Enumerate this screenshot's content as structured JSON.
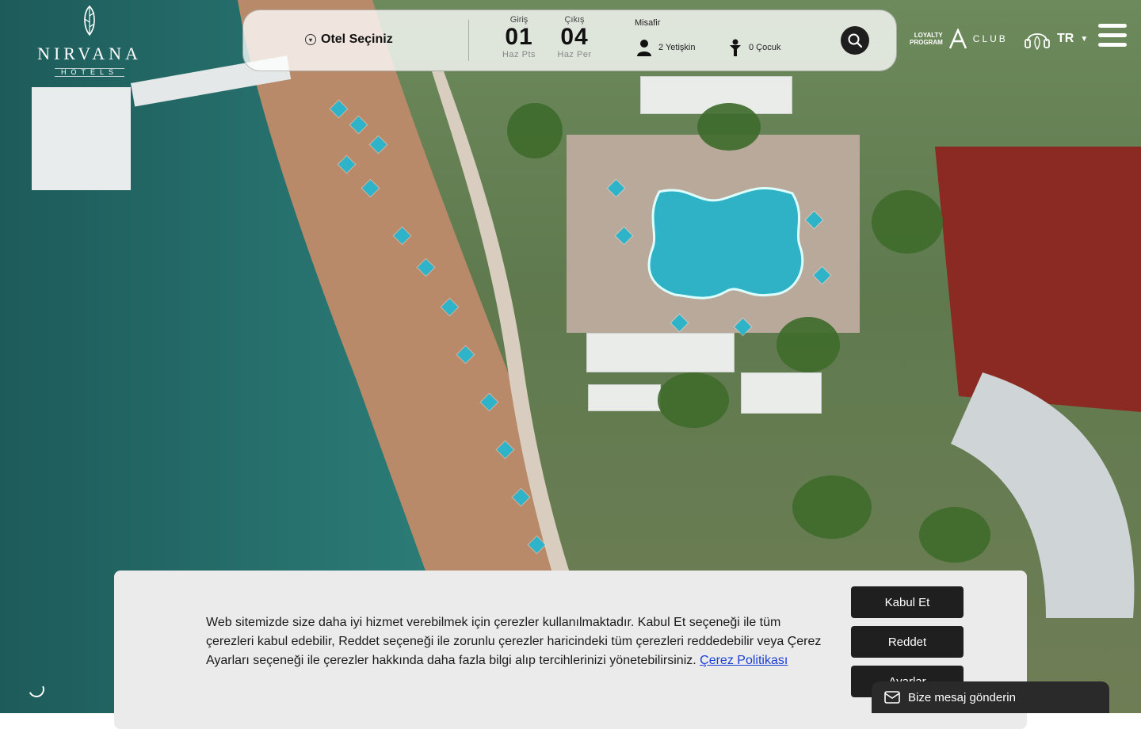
{
  "logo": {
    "brand": "NIRVANA",
    "sub": "HOTELS"
  },
  "booking": {
    "hotel_label": "Otel Seçiniz",
    "checkin": {
      "label": "Giriş",
      "day": "01",
      "dow": "Haz Pts"
    },
    "checkout": {
      "label": "Çıkış",
      "day": "04",
      "dow": "Haz Per"
    },
    "guest_label": "Misafir",
    "adults": "2 Yetişkin",
    "children": "0 Çocuk"
  },
  "loyalty": {
    "line1": "LOYALTY",
    "line2": "PROGRAM",
    "club": "CLUB"
  },
  "language": {
    "code": "TR"
  },
  "cookie": {
    "text": "Web sitemizde size daha iyi hizmet verebilmek için çerezler kullanılmaktadır. Kabul Et seçeneği ile tüm çerezleri kabul edebilir, Reddet seçeneği ile zorunlu çerezler haricindeki tüm çerezleri reddedebilir veya Çerez Ayarları seçeneği ile çerezler hakkında daha fazla bilgi alıp tercihlerinizi yönetebilirsiniz.",
    "policy_link": "Çerez Politikası",
    "accept": "Kabul Et",
    "reject": "Reddet",
    "settings": "Ayarlar"
  },
  "message_bar": {
    "label": "Bize mesaj gönderin"
  }
}
